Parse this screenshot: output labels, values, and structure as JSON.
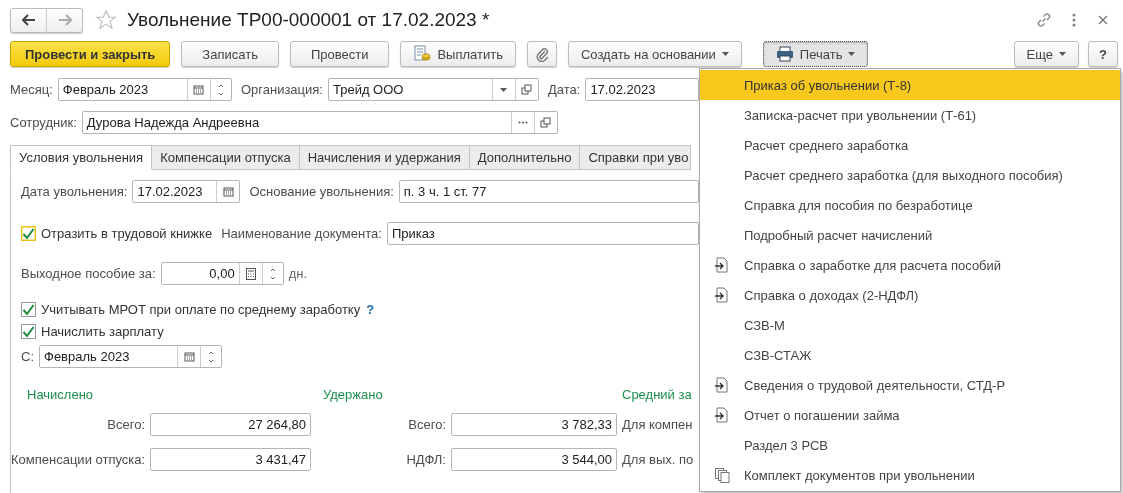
{
  "window": {
    "title": "Увольнение ТР00-000001 от 17.02.2023 *",
    "favorite": false
  },
  "toolbar": [
    {
      "label": "Провести и закрыть",
      "kind": "primary",
      "pressed": false
    },
    {
      "label": "Записать",
      "kind": "plain",
      "pressed": false
    },
    {
      "label": "Провести",
      "kind": "plain",
      "pressed": false
    },
    {
      "label": "Выплатить",
      "kind": "pay",
      "pressed": false
    },
    {
      "kind": "attach",
      "pressed": false
    },
    {
      "label": "Создать на основании",
      "kind": "dropdown",
      "pressed": false
    },
    {
      "label": "Печать",
      "kind": "print",
      "pressed": true
    }
  ],
  "toolbar_right": [
    {
      "label": "Еще",
      "kind": "dropdown",
      "pressed": false
    },
    {
      "label": "?",
      "kind": "plain",
      "pressed": false
    }
  ],
  "header": {
    "month": {
      "label": "Месяц:",
      "value": "Февраль 2023"
    },
    "organization": {
      "label": "Организация:",
      "value": "Трейд ООО"
    },
    "date": {
      "label": "Дата:",
      "value": "17.02.2023"
    },
    "employee": {
      "label": "Сотрудник:",
      "value": "Дурова Надежда Андреевна"
    }
  },
  "tabs": [
    {
      "label": "Условия увольнения",
      "selected": true
    },
    {
      "label": "Компенсации отпуска",
      "selected": false
    },
    {
      "label": "Начисления и удержания",
      "selected": false
    },
    {
      "label": "Дополнительно",
      "selected": false
    },
    {
      "label": "Справки при уво",
      "selected": false
    }
  ],
  "conditions": {
    "dismissal_date": {
      "label": "Дата увольнения:",
      "value": "17.02.2023"
    },
    "dismissal_basis": {
      "label": "Основание увольнения:",
      "value": "п. 3 ч. 1 ст. 77"
    },
    "workbook": {
      "label": "Отразить в трудовой книжке",
      "checked": true,
      "focused": true
    },
    "document_name": {
      "label": "Наименование документа:",
      "value": "Приказ"
    },
    "severance": {
      "label": "Выходное пособие за:",
      "value": "0,00",
      "unit": "дн."
    },
    "mrot": {
      "label": "Учитывать МРОТ при оплате по среднему заработку",
      "checked": true,
      "help": "?"
    },
    "accrue_salary": {
      "label": "Начислить зарплату",
      "checked": true
    },
    "from": {
      "label": "С:",
      "value": "Февраль 2023"
    }
  },
  "summary": [
    {
      "heading": "Начислено",
      "rows": [
        {
          "label": "Всего:",
          "value": "27 264,80"
        },
        {
          "label": "Компенсации отпуска:",
          "value": "3 431,47"
        }
      ]
    },
    {
      "heading": "Удержано",
      "rows": [
        {
          "label": "Всего:",
          "value": "3 782,33"
        },
        {
          "label": "НДФЛ:",
          "value": "3 544,00"
        }
      ]
    },
    {
      "heading": "Средний за",
      "rows": [
        {
          "label": "Для компен"
        },
        {
          "label": "Для вых. по"
        }
      ]
    }
  ],
  "print_menu": [
    {
      "label": "Приказ об увольнении (Т-8)",
      "kind": "plain",
      "selected": true
    },
    {
      "label": "Записка-расчет при увольнении (Т-61)",
      "kind": "plain",
      "selected": false
    },
    {
      "label": "Расчет среднего заработка",
      "kind": "plain",
      "selected": false
    },
    {
      "label": "Расчет среднего заработка (для выходного пособия)",
      "kind": "plain",
      "selected": false
    },
    {
      "label": "Справка для пособия по безработице",
      "kind": "plain",
      "selected": false
    },
    {
      "label": "Подробный расчет начислений",
      "kind": "plain",
      "selected": false
    },
    {
      "label": "Справка о заработке для расчета пособий",
      "kind": "export",
      "selected": false
    },
    {
      "label": "Справка о доходах (2-НДФЛ)",
      "kind": "export",
      "selected": false
    },
    {
      "label": "СЗВ-М",
      "kind": "plain",
      "selected": false
    },
    {
      "label": "СЗВ-СТАЖ",
      "kind": "plain",
      "selected": false
    },
    {
      "label": "Сведения о трудовой деятельности, СТД-Р",
      "kind": "export",
      "selected": false
    },
    {
      "label": "Отчет о погашении займа",
      "kind": "export",
      "selected": false
    },
    {
      "label": "Раздел 3 РСВ",
      "kind": "plain",
      "selected": false
    },
    {
      "label": "Комплект документов при увольнении",
      "kind": "set",
      "selected": false
    }
  ]
}
